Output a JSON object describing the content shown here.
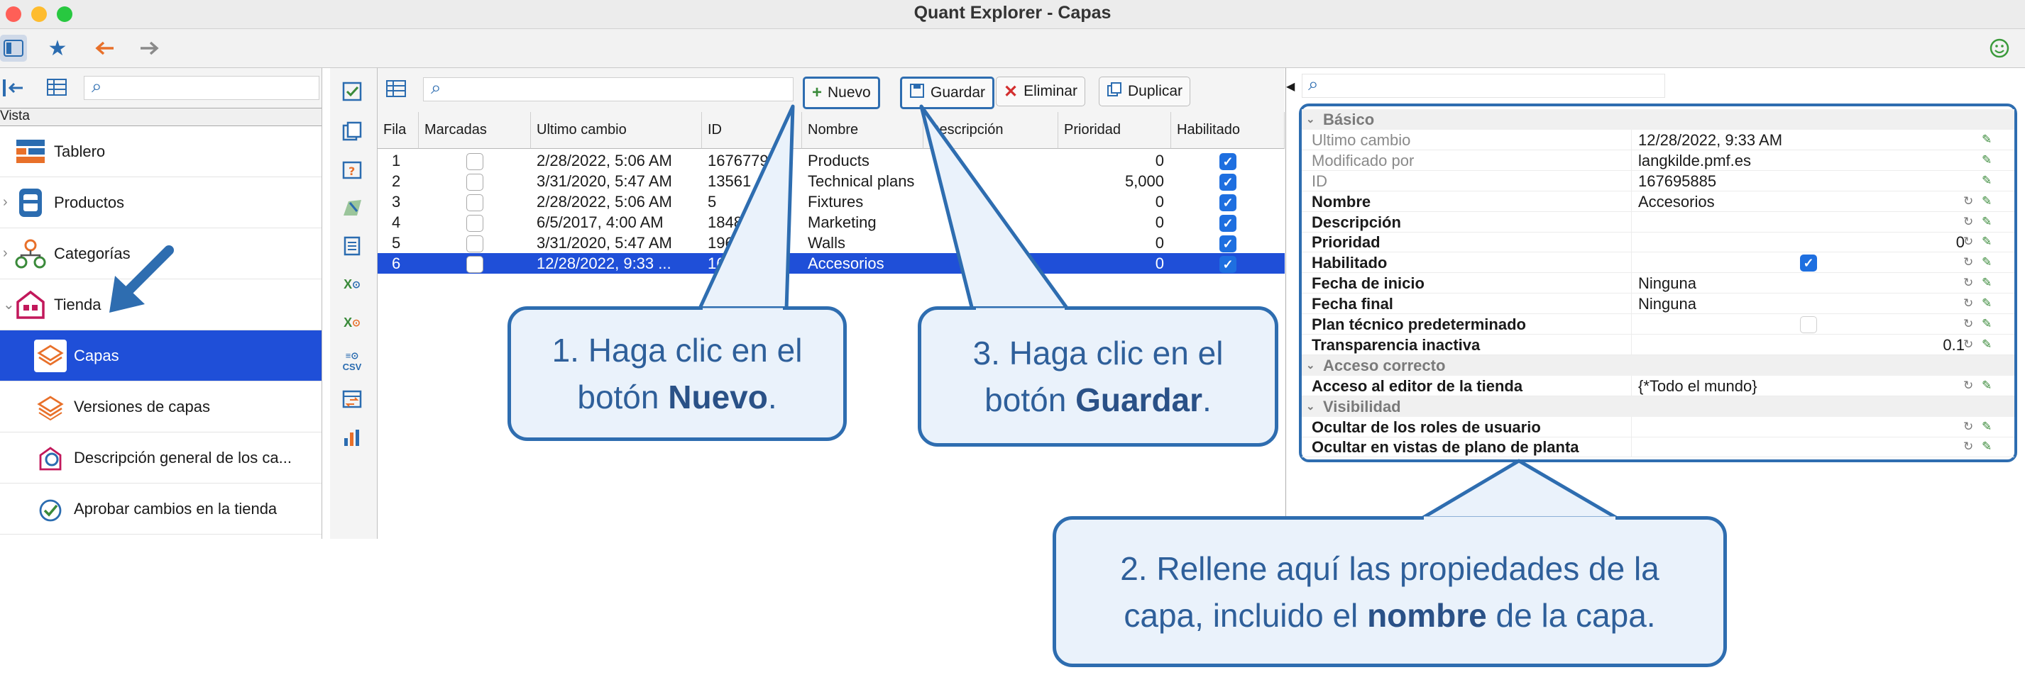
{
  "window": {
    "title": "Quant Explorer - Capas"
  },
  "toolbar": {
    "icons": [
      "sidebar-toggle-icon",
      "star-icon",
      "back-arrow-icon",
      "forward-arrow-icon",
      "smiley-icon"
    ]
  },
  "left": {
    "vista_label": "Vista",
    "items": [
      {
        "label": "Tablero",
        "icon": "dashboard-icon"
      },
      {
        "label": "Productos",
        "icon": "database-icon"
      },
      {
        "label": "Categorías",
        "icon": "hierarchy-icon"
      },
      {
        "label": "Tienda",
        "icon": "store-icon"
      },
      {
        "label": "Capas",
        "icon": "layers-icon"
      },
      {
        "label": "Versiones de capas",
        "icon": "layer-versions-icon"
      },
      {
        "label": "Descripción general de los ca...",
        "icon": "overview-icon"
      },
      {
        "label": "Aprobar cambios en la tienda",
        "icon": "approve-icon"
      }
    ]
  },
  "center": {
    "buttons": {
      "new": "Nuevo",
      "save": "Guardar",
      "delete": "Eliminar",
      "duplicate": "Duplicar"
    },
    "columns": [
      "Fila",
      "Marcadas",
      "Ultimo cambio",
      "ID",
      "Nombre",
      "Descripción",
      "Prioridad",
      "Habilitado"
    ],
    "rows": [
      {
        "fila": "1",
        "marcada": false,
        "cambio": "2/28/2022, 5:06 AM",
        "id": "167677910",
        "nombre": "Products",
        "desc": "",
        "prioridad": "0",
        "habilitado": true
      },
      {
        "fila": "2",
        "marcada": false,
        "cambio": "3/31/2020, 5:47 AM",
        "id": "13561",
        "nombre": "Technical plans",
        "desc": "",
        "prioridad": "5,000",
        "habilitado": true
      },
      {
        "fila": "3",
        "marcada": false,
        "cambio": "2/28/2022, 5:06 AM",
        "id": "5",
        "nombre": "Fixtures",
        "desc": "",
        "prioridad": "0",
        "habilitado": true
      },
      {
        "fila": "4",
        "marcada": false,
        "cambio": "6/5/2017, 4:00 AM",
        "id": "18486",
        "nombre": "Marketing",
        "desc": "",
        "prioridad": "0",
        "habilitado": true
      },
      {
        "fila": "5",
        "marcada": false,
        "cambio": "3/31/2020, 5:47 AM",
        "id": "1962",
        "nombre": "Walls",
        "desc": "",
        "prioridad": "0",
        "habilitado": true
      },
      {
        "fila": "6",
        "marcada": false,
        "cambio": "12/28/2022, 9:33 ...",
        "id": "167",
        "nombre": "Accesorios",
        "desc": "",
        "prioridad": "0",
        "habilitado": true
      }
    ]
  },
  "props": {
    "rows": [
      {
        "kind": "cat",
        "name": "Básico"
      },
      {
        "kind": "gray",
        "name": "Ultimo cambio",
        "value": "12/28/2022, 9:33 AM"
      },
      {
        "kind": "gray",
        "name": "Modificado por",
        "value": "langkilde.pmf.es"
      },
      {
        "kind": "gray",
        "name": "ID",
        "value": "167695885"
      },
      {
        "kind": "bold",
        "name": "Nombre",
        "value": "Accesorios"
      },
      {
        "kind": "bold",
        "name": "Descripción",
        "value": ""
      },
      {
        "kind": "bold",
        "name": "Prioridad",
        "value": "",
        "right": "0"
      },
      {
        "kind": "bold",
        "name": "Habilitado",
        "value": "",
        "check": "on"
      },
      {
        "kind": "bold",
        "name": "Fecha de inicio",
        "value": "Ninguna"
      },
      {
        "kind": "bold",
        "name": "Fecha final",
        "value": "Ninguna"
      },
      {
        "kind": "bold",
        "name": "Plan técnico predeterminado",
        "value": "",
        "check": "off"
      },
      {
        "kind": "bold",
        "name": "Transparencia inactiva",
        "value": "",
        "right": "0.1"
      },
      {
        "kind": "cat",
        "name": "Acceso correcto"
      },
      {
        "kind": "bold",
        "name": "Acceso al editor de la tienda",
        "value": "{*Todo el mundo}"
      },
      {
        "kind": "cat",
        "name": "Visibilidad"
      },
      {
        "kind": "bold",
        "name": "Ocultar de los roles de usuario",
        "value": ""
      },
      {
        "kind": "bold",
        "name": "Ocultar en vistas de plano de planta",
        "value": ""
      }
    ]
  },
  "callouts": {
    "c1": {
      "pre": "1. Haga clic en el botón ",
      "strong": "Nuevo",
      "post": "."
    },
    "c2": {
      "pre": "2. Rellene aquí las propiedades de la capa, incluido el ",
      "strong": "nombre",
      "post": " de la capa."
    },
    "c3": {
      "pre": "3. Haga clic en el botón ",
      "strong": "Guardar",
      "post": "."
    }
  },
  "colors": {
    "accent": "#2e6db0",
    "selection": "#1f4fd8",
    "callout_fill": "#eaf2fb"
  }
}
